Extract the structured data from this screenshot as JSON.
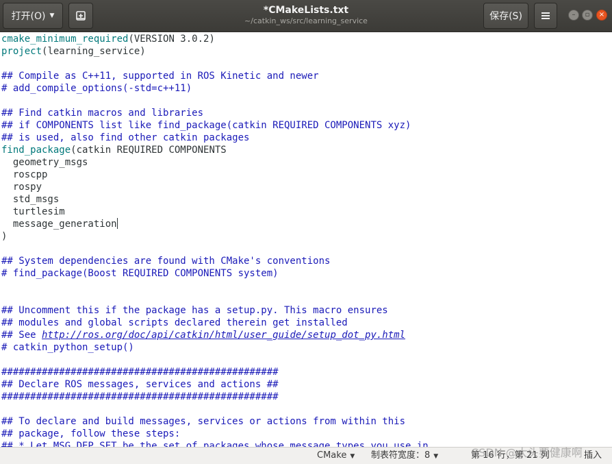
{
  "header": {
    "open_label": "打开(O)",
    "save_label": "保存(S)",
    "title": "*CMakeLists.txt",
    "subtitle": "~/catkin_ws/src/learning_service"
  },
  "code_lines": [
    [
      {
        "t": "cmake_minimum_required",
        "c": "func"
      },
      {
        "t": "(VERSION 3.0.2)",
        "c": "plain"
      }
    ],
    [
      {
        "t": "project",
        "c": "func"
      },
      {
        "t": "(learning_service)",
        "c": "plain"
      }
    ],
    [],
    [
      {
        "t": "## Compile as C++11, supported in ROS Kinetic and newer",
        "c": "comment"
      }
    ],
    [
      {
        "t": "# add_compile_options(-std=c++11)",
        "c": "comment"
      }
    ],
    [],
    [
      {
        "t": "## Find catkin macros and libraries",
        "c": "comment"
      }
    ],
    [
      {
        "t": "## if COMPONENTS list like find_package(catkin REQUIRED COMPONENTS xyz)",
        "c": "comment"
      }
    ],
    [
      {
        "t": "## is used, also find other catkin packages",
        "c": "comment"
      }
    ],
    [
      {
        "t": "find_package",
        "c": "func"
      },
      {
        "t": "(catkin REQUIRED COMPONENTS",
        "c": "plain"
      }
    ],
    [
      {
        "t": "  geometry_msgs",
        "c": "plain"
      }
    ],
    [
      {
        "t": "  roscpp",
        "c": "plain"
      }
    ],
    [
      {
        "t": "  rospy",
        "c": "plain"
      }
    ],
    [
      {
        "t": "  std_msgs",
        "c": "plain"
      }
    ],
    [
      {
        "t": "  turtlesim",
        "c": "plain"
      }
    ],
    [
      {
        "t": "  message_generation",
        "c": "plain"
      },
      {
        "t": "",
        "c": "cursor"
      }
    ],
    [
      {
        "t": ")",
        "c": "plain"
      }
    ],
    [],
    [
      {
        "t": "## System dependencies are found with CMake's conventions",
        "c": "comment"
      }
    ],
    [
      {
        "t": "# find_package(Boost REQUIRED COMPONENTS system)",
        "c": "comment"
      }
    ],
    [],
    [],
    [
      {
        "t": "## Uncomment this if the package has a setup.py. This macro ensures",
        "c": "comment"
      }
    ],
    [
      {
        "t": "## modules and global scripts declared therein get installed",
        "c": "comment"
      }
    ],
    [
      {
        "t": "## See ",
        "c": "comment"
      },
      {
        "t": "http://ros.org/doc/api/catkin/html/user_guide/setup_dot_py.html",
        "c": "link"
      }
    ],
    [
      {
        "t": "# catkin_python_setup()",
        "c": "comment"
      }
    ],
    [],
    [
      {
        "t": "################################################",
        "c": "comment"
      }
    ],
    [
      {
        "t": "## Declare ROS messages, services and actions ##",
        "c": "comment"
      }
    ],
    [
      {
        "t": "################################################",
        "c": "comment"
      }
    ],
    [],
    [
      {
        "t": "## To declare and build messages, services or actions from within this",
        "c": "comment"
      }
    ],
    [
      {
        "t": "## package, follow these steps:",
        "c": "comment"
      }
    ],
    [
      {
        "t": "## * Let MSG_DEP_SET be the set of packages whose message types you use in",
        "c": "comment"
      }
    ]
  ],
  "status": {
    "language": "CMake",
    "tab_width": "制表符宽度：8",
    "position": "第 16 行，第 21 列",
    "mode": "插入"
  },
  "watermark": "CSDN @大头要健康啊",
  "colors": {
    "comment": "#1a1ab8",
    "function": "#00787a",
    "text": "#2e3436",
    "headerbar": "#3c3b37",
    "close_button": "#e95420"
  }
}
